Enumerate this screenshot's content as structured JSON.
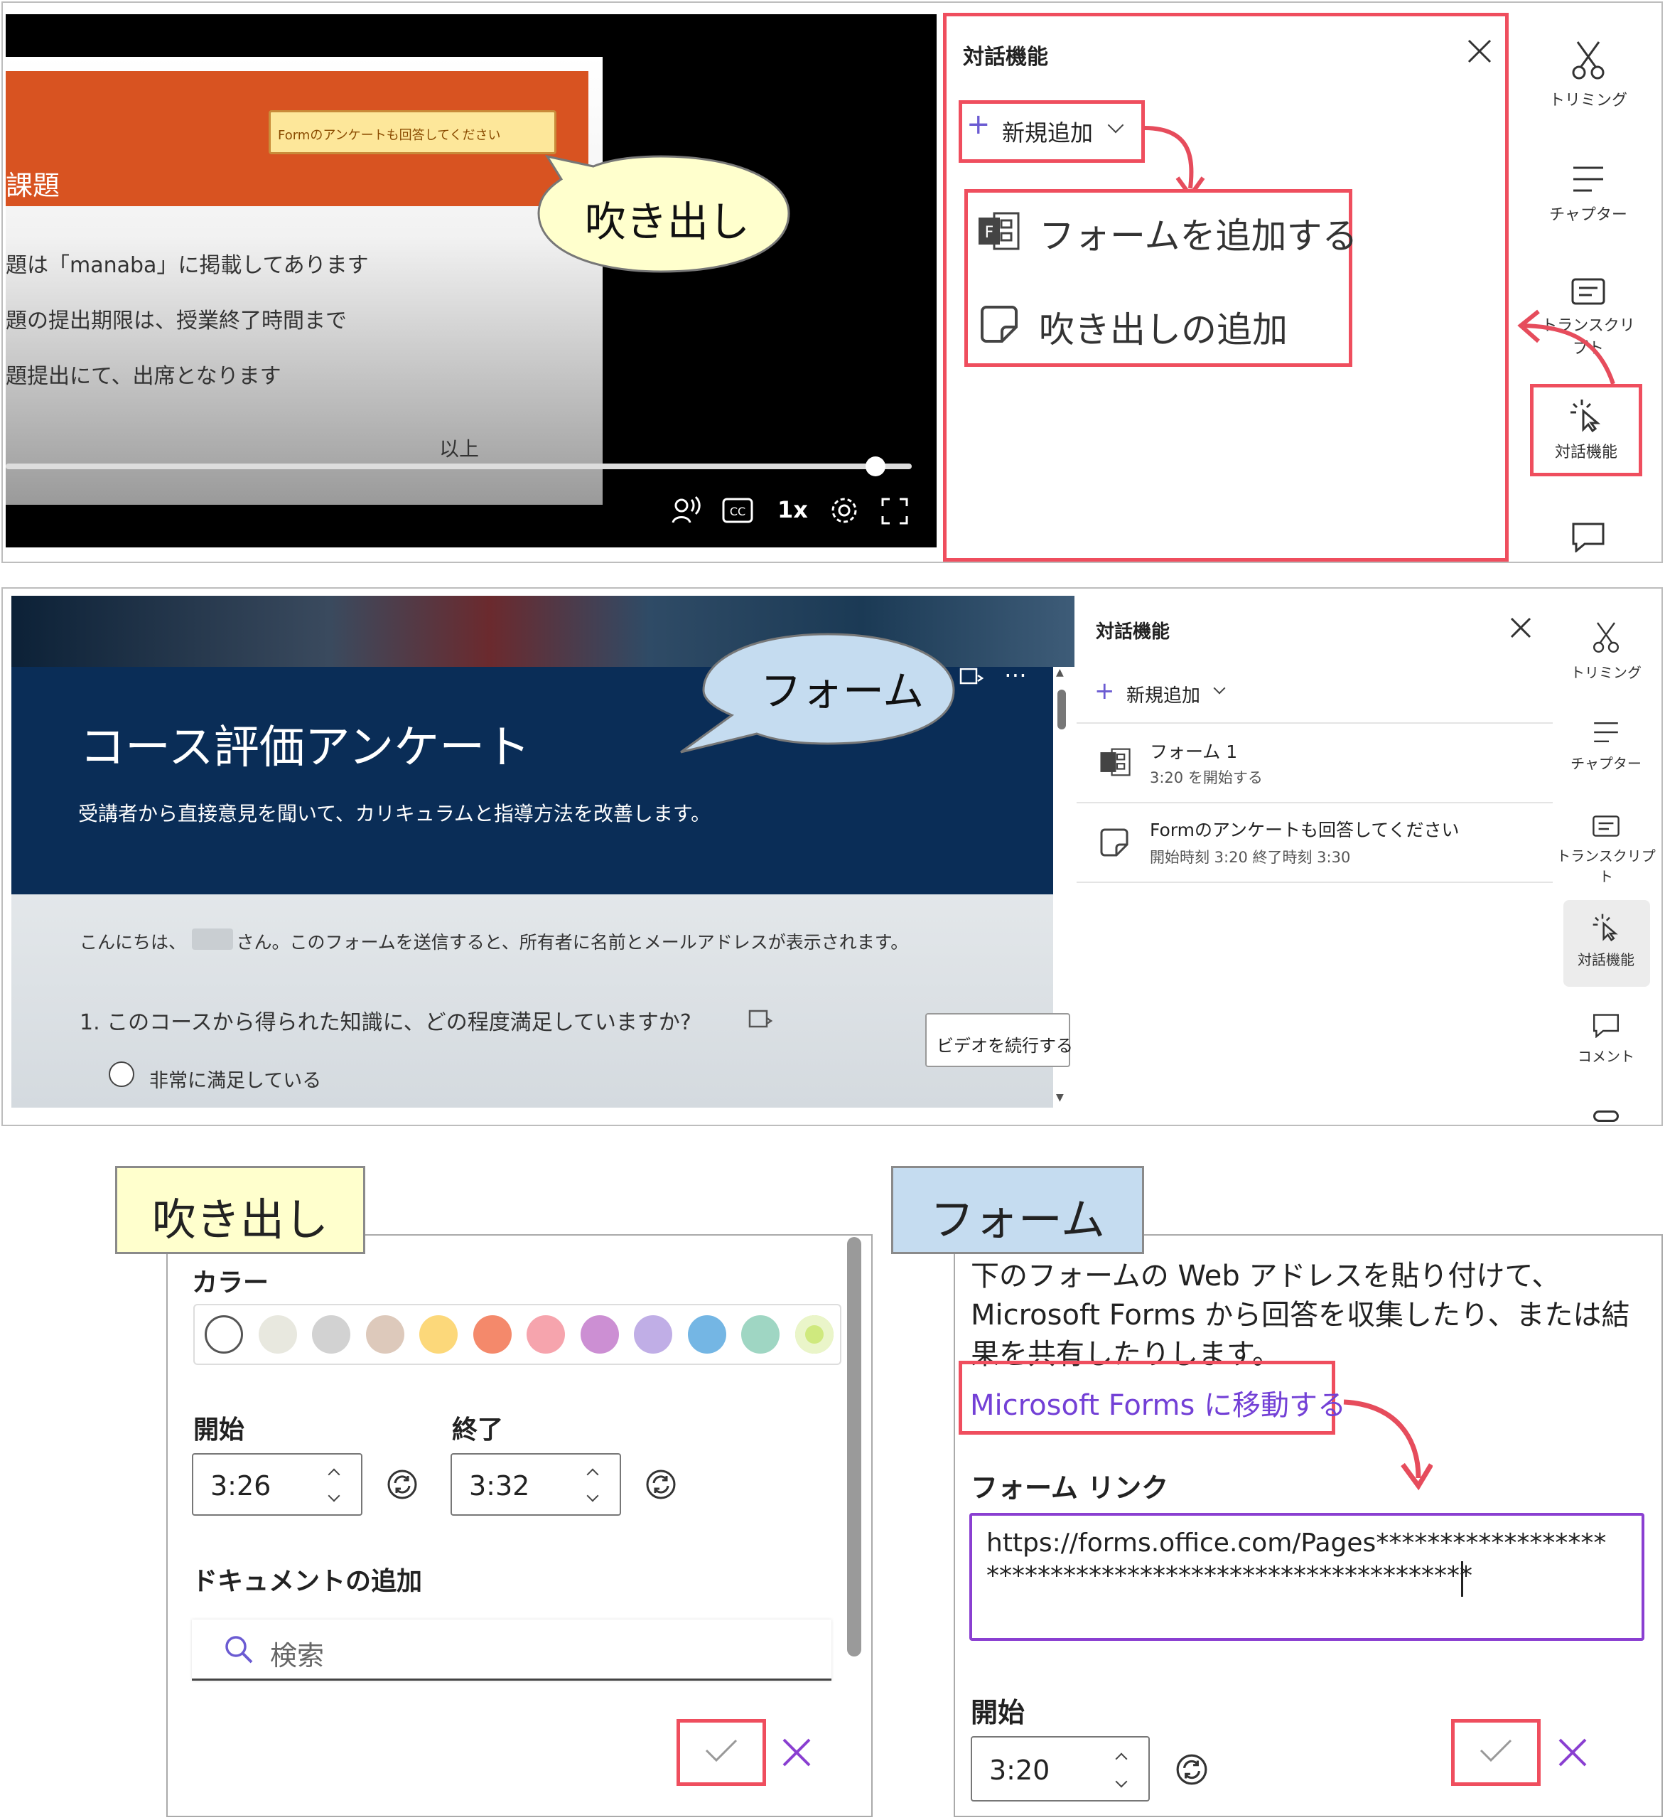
{
  "top": {
    "slide": {
      "callout_text": "Formのアンケートも回答してください",
      "title_fragment": "課題",
      "line1": "題は「manaba」に掲載してあります",
      "line2": "題の提出期限は、授業終了時間まで",
      "line3": "題提出にて、出席となります",
      "ending": "以上"
    },
    "bubble_label": "吹き出し",
    "controls": {
      "speed": "1x"
    },
    "panel": {
      "title": "対話機能",
      "add_new": "新規追加",
      "menu_form": "フォームを追加する",
      "menu_callout": "吹き出しの追加"
    },
    "rail": {
      "trim": "トリミング",
      "chapters": "チャプター",
      "transcript": "トランスクリプト",
      "interactive": "対話機能"
    }
  },
  "middle": {
    "bubble_label": "フォーム",
    "form": {
      "title": "コース評価アンケート",
      "subtitle": "受講者から直接意見を聞いて、カリキュラムと指導方法を改善します。",
      "greeting": "こんにちは、　　　 さん。このフォームを送信すると、所有者に名前とメールアドレスが表示されます。",
      "question": "1. このコースから得られた知識に、どの程度満足していますか?",
      "option1": "非常に満足している",
      "continue": "ビデオを続行する"
    },
    "panel": {
      "title": "対話機能",
      "add_new": "新規追加",
      "item1_title": "フォーム 1",
      "item1_sub": "3:20 を開始する",
      "item2_title": "Formのアンケートも回答してください",
      "item2_sub": "開始時刻 3:20 終了時刻 3:30"
    },
    "rail": {
      "trim": "トリミング",
      "chapters": "チャプター",
      "transcript": "トランスクリプト",
      "interactive": "対話機能",
      "comment": "コメント"
    }
  },
  "bottom_left": {
    "tag": "吹き出し",
    "color_label": "カラー",
    "colors": [
      "#ffffff",
      "#e8e8df",
      "#d2d2d2",
      "#ddc9bb",
      "#fcd87a",
      "#f4896b",
      "#f6a4ad",
      "#cc8fd3",
      "#c0aee6",
      "#74b6e4",
      "#9fd6c3",
      "#cfe97e"
    ],
    "start_label": "開始",
    "end_label": "終了",
    "start_value": "3:26",
    "end_value": "3:32",
    "doc_label": "ドキュメントの追加",
    "search_placeholder": "検索"
  },
  "bottom_right": {
    "tag": "フォーム",
    "description": "下のフォームの Web アドレスを貼り付けて、Microsoft Forms から回答を収集したり、または結果を共有したりします。",
    "link_text": "Microsoft Forms に移動する",
    "form_link_label": "フォーム リンク",
    "url_line1": "https://forms.office.com/Pages******************",
    "url_line2": "**************************************",
    "start_label": "開始",
    "start_value": "3:20"
  }
}
